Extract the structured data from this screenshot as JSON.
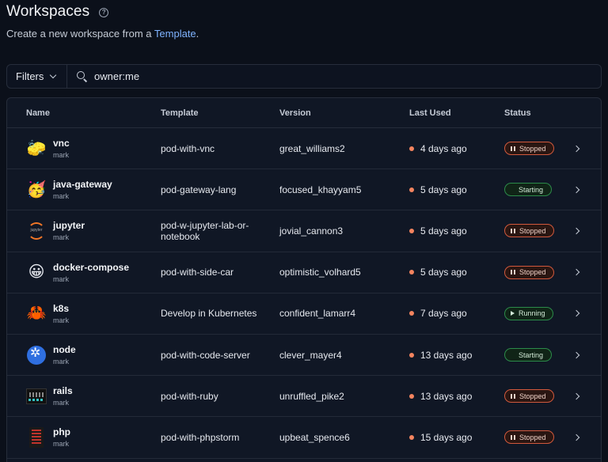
{
  "header": {
    "title": "Workspaces",
    "subtitle_prefix": "Create a new workspace from a ",
    "subtitle_link": "Template",
    "subtitle_suffix": "."
  },
  "search": {
    "filters_label": "Filters",
    "value": "owner:me"
  },
  "table": {
    "columns": [
      "Name",
      "Template",
      "Version",
      "Last Used",
      "Status"
    ],
    "rows": [
      {
        "name": "vnc",
        "owner": "mark",
        "avatar": "sponge-icon",
        "template": "pod-with-vnc",
        "version": "great_williams2",
        "last_used": "4 days ago",
        "status": "Stopped"
      },
      {
        "name": "java-gateway",
        "owner": "mark",
        "avatar": "party-face-icon",
        "template": "pod-gateway-lang",
        "version": "focused_khayyam5",
        "last_used": "5 days ago",
        "status": "Starting"
      },
      {
        "name": "jupyter",
        "owner": "mark",
        "avatar": "jupyter-icon",
        "template": "pod-w-jupyter-lab-or-notebook",
        "version": "jovial_cannon3",
        "last_used": "5 days ago",
        "status": "Stopped"
      },
      {
        "name": "docker-compose",
        "owner": "mark",
        "avatar": "smiley-icon",
        "template": "pod-with-side-car",
        "version": "optimistic_volhard5",
        "last_used": "5 days ago",
        "status": "Stopped"
      },
      {
        "name": "k8s",
        "owner": "mark",
        "avatar": "crab-icon",
        "template": "Develop in Kubernetes",
        "version": "confident_lamarr4",
        "last_used": "7 days ago",
        "status": "Running"
      },
      {
        "name": "node",
        "owner": "mark",
        "avatar": "kubernetes-icon",
        "template": "pod-with-code-server",
        "version": "clever_mayer4",
        "last_used": "13 days ago",
        "status": "Starting"
      },
      {
        "name": "rails",
        "owner": "mark",
        "avatar": "pixel-icon",
        "template": "pod-with-ruby",
        "version": "unruffled_pike2",
        "last_used": "13 days ago",
        "status": "Stopped"
      },
      {
        "name": "php",
        "owner": "mark",
        "avatar": "php-icon",
        "template": "pod-with-phpstorm",
        "version": "upbeat_spence6",
        "last_used": "15 days ago",
        "status": "Stopped"
      }
    ]
  },
  "colors": {
    "background": "#0b101a",
    "link": "#7fb3ff",
    "stopped": "#d2593d",
    "running": "#2c8b4a",
    "last_used_dot": "#f4845f"
  }
}
